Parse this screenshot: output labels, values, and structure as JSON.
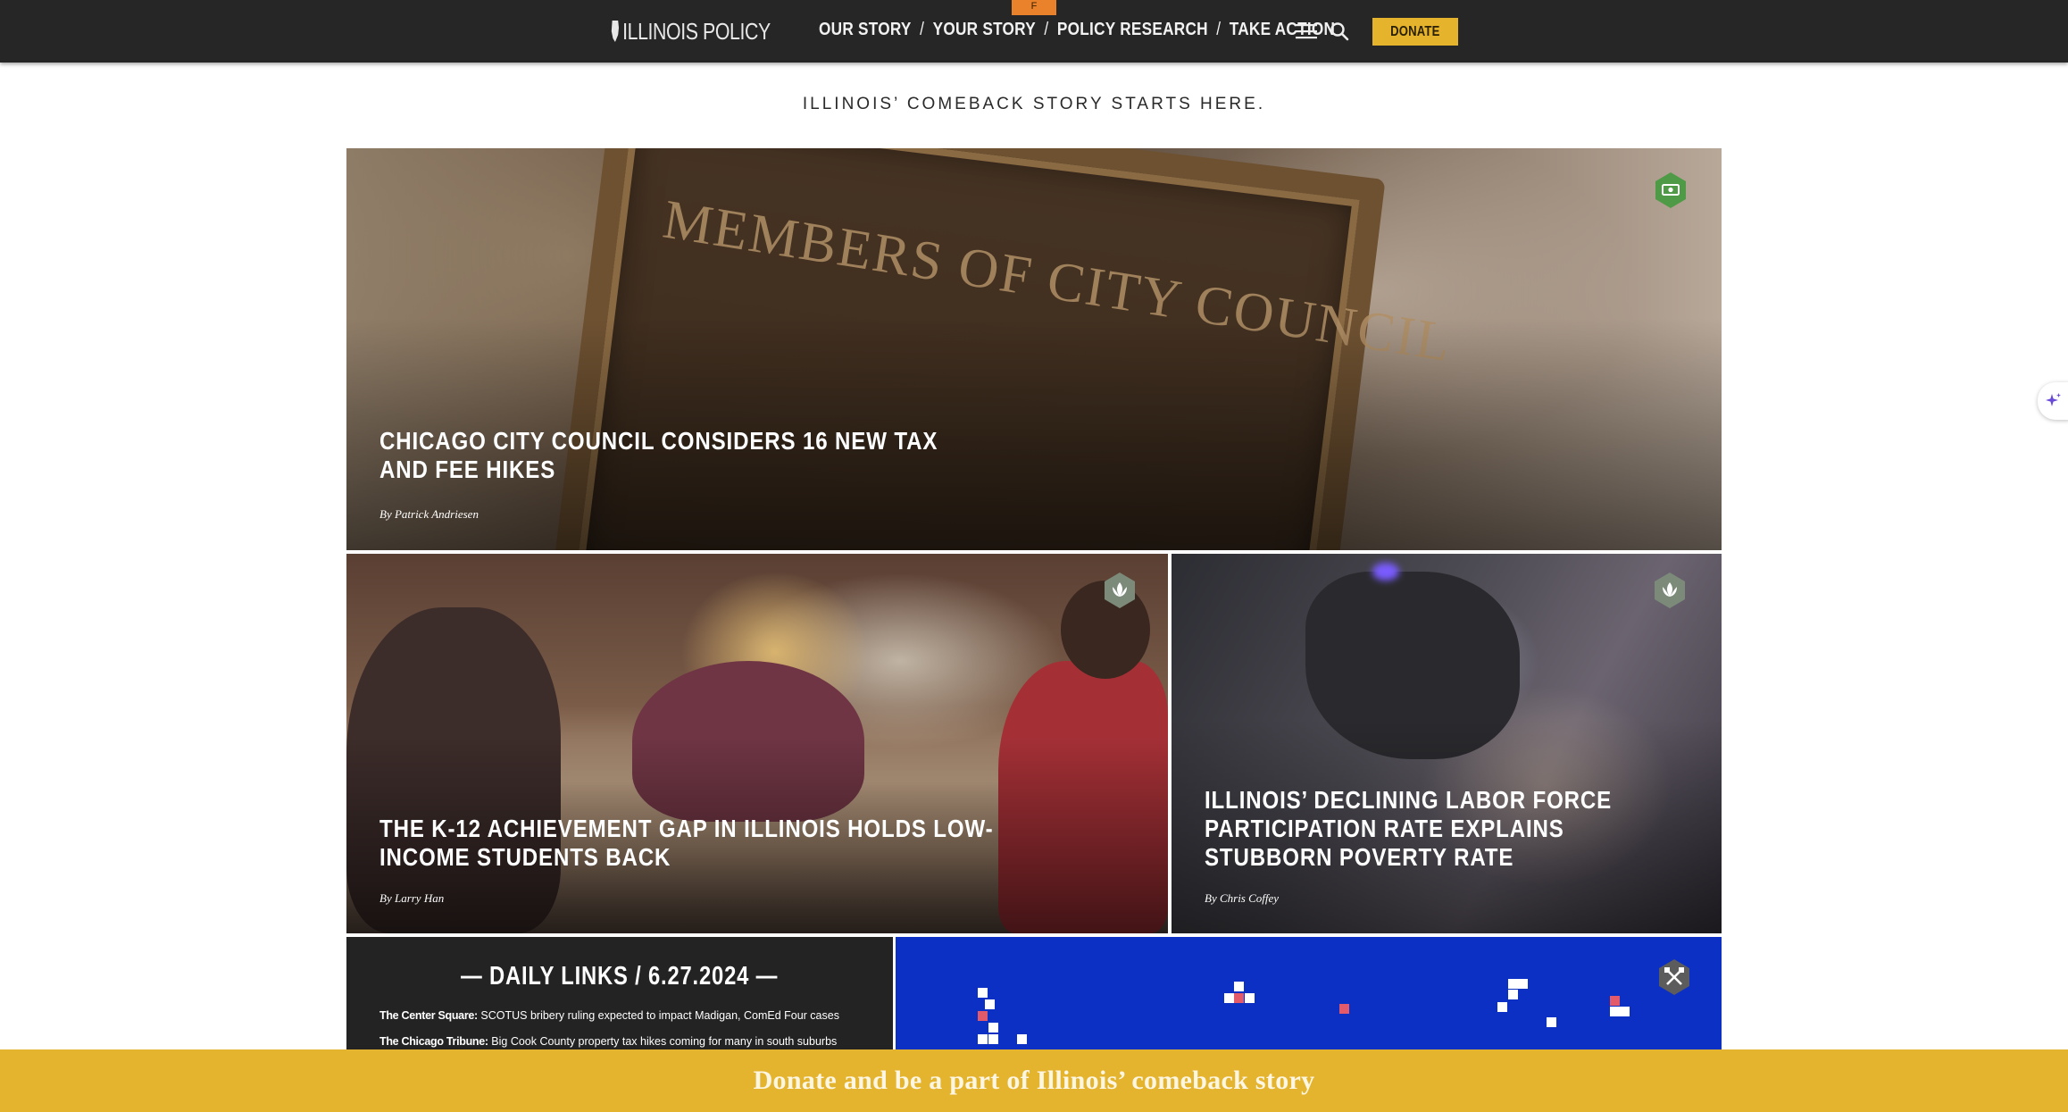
{
  "nav": {
    "logo_text": "ILLINOIS POLICY",
    "tab_marker": "F",
    "links": [
      "OUR STORY",
      "YOUR STORY",
      "POLICY RESEARCH",
      "TAKE ACTION"
    ],
    "separator": "/",
    "donate_label": "DONATE"
  },
  "tagline": "ILLINOIS’ COMEBACK STORY STARTS HERE.",
  "hero": {
    "plaque_text": "MEMBERS OF CITY COUNCIL",
    "title": "CHICAGO CITY COUNCIL CONSIDERS 16 NEW TAX AND FEE HIKES",
    "byline": "By Patrick Andriesen",
    "badge_icon": "money-icon"
  },
  "articles": [
    {
      "title": "THE K-12 ACHIEVEMENT GAP IN ILLINOIS HOLDS LOW-INCOME STUDENTS BACK",
      "byline": "By Larry Han",
      "badge_icon": "lotus-icon"
    },
    {
      "title": "ILLINOIS’ DECLINING LABOR FORCE PARTICIPATION RATE EXPLAINS STUBBORN POVERTY RATE",
      "byline": "By Chris Coffey",
      "badge_icon": "lotus-icon"
    }
  ],
  "daily_links": {
    "title": "— DAILY LINKS / 6.27.2024 —",
    "items": [
      {
        "source": "The Center Square:",
        "text": "SCOTUS bribery ruling expected to impact Madigan, ComEd Four cases"
      },
      {
        "source": "The Chicago Tribune:",
        "text": "Big Cook County property tax hikes coming for many in south suburbs"
      }
    ]
  },
  "blue_card": {
    "badge_icon": "tools-icon"
  },
  "banner": {
    "text": "Donate and be a part of Illinois’ comeback story"
  },
  "colors": {
    "nav_bg": "#262626",
    "accent_gold": "#e6b32d",
    "badge_green": "#4f9a46",
    "blue_card": "#0c2fc4",
    "tab_orange": "#e9822a"
  }
}
